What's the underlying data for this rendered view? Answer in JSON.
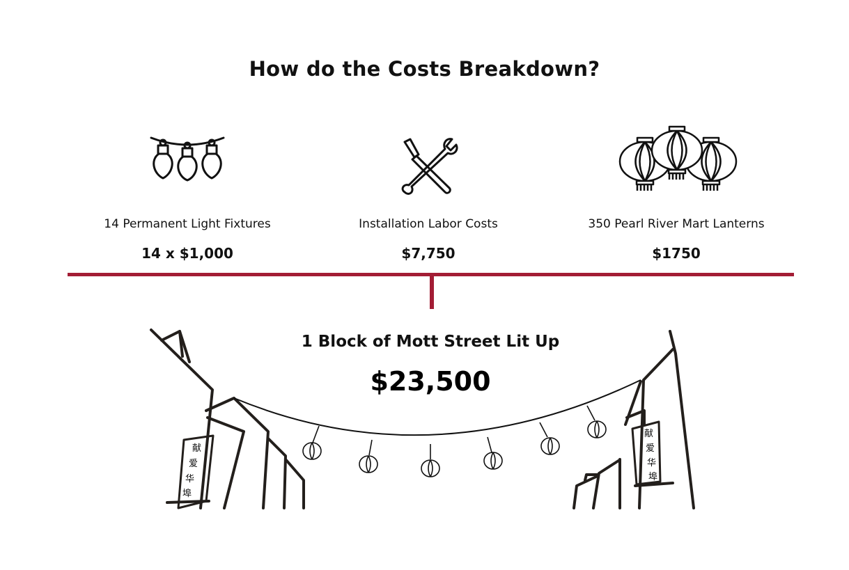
{
  "title": "How do the Costs Breakdown?",
  "items": [
    {
      "icon": "string-lights-icon",
      "label": "14 Permanent Light Fixtures",
      "value": "14 x $1,000"
    },
    {
      "icon": "wrench-screwdriver-icon",
      "label": "Installation Labor Costs",
      "value": "$7,750"
    },
    {
      "icon": "lanterns-icon",
      "label": "350 Pearl River Mart Lanterns",
      "value": "$1750"
    }
  ],
  "total": {
    "label": "1 Block of Mott Street Lit Up",
    "value": "$23,500"
  },
  "signs": {
    "left": [
      "献",
      "爱",
      "华",
      "埠"
    ],
    "right": [
      "献",
      "爱",
      "华",
      "埠"
    ]
  },
  "colors": {
    "accent": "#a31d35",
    "ink": "#111111"
  }
}
